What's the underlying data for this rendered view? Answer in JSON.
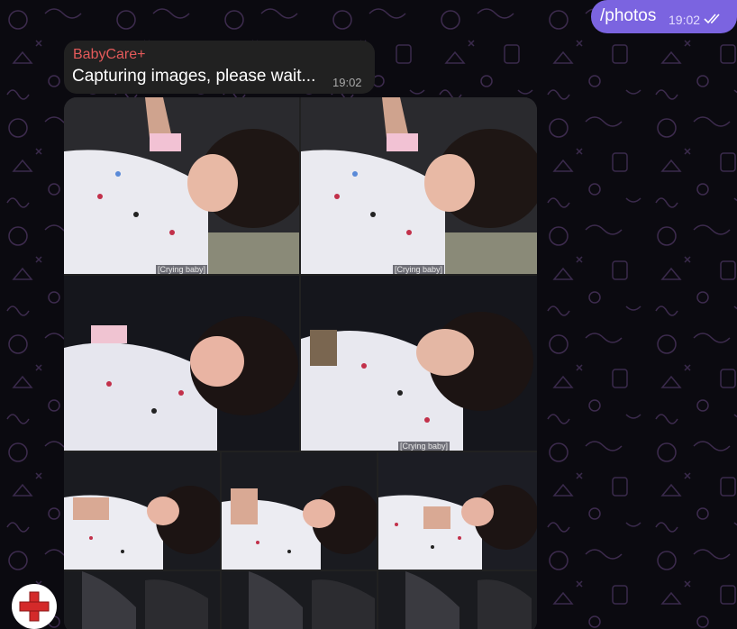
{
  "outgoing": {
    "text": "/photos",
    "time": "19:02",
    "status_icon": "double-check-icon"
  },
  "incoming": {
    "sender": "BabyCare+",
    "text": "Capturing images, please wait...",
    "time": "19:02"
  },
  "album": {
    "photos": [
      {
        "caption": "[Crying baby]"
      },
      {
        "caption": "[Crying baby]"
      },
      {
        "caption": ""
      },
      {
        "caption": "[Crying baby]"
      },
      {
        "caption": ""
      },
      {
        "caption": ""
      },
      {
        "caption": ""
      },
      {
        "caption": ""
      },
      {
        "caption": ""
      },
      {
        "caption": ""
      }
    ]
  },
  "avatar": {
    "icon": "medical-cross-icon"
  },
  "colors": {
    "outgoing_bubble": "#7b64e0",
    "incoming_bubble": "#212121",
    "sender_name": "#e35a5a",
    "background": "#0b0a10",
    "doodle": "#3a2a4a",
    "avatar_cross": "#d42a2a"
  }
}
